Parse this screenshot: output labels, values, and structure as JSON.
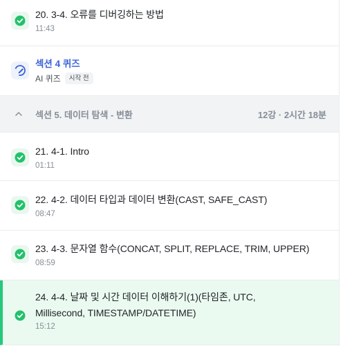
{
  "lessons_top": [
    {
      "title": "20. 3-4. 오류를 디버깅하는 방법",
      "time": "11:43"
    }
  ],
  "quiz": {
    "title": "섹션 4 퀴즈",
    "label": "AI 퀴즈",
    "badge": "시작 전"
  },
  "section": {
    "title": "섹션 5. 데이터 탐색 - 변환",
    "meta": "12강 · 2시간 18분"
  },
  "lessons": [
    {
      "title": "21. 4-1. Intro",
      "time": "01:11"
    },
    {
      "title": "22. 4-2. 데이터 타입과 데이터 변환(CAST, SAFE_CAST)",
      "time": "08:47"
    },
    {
      "title": "23. 4-3. 문자열 함수(CONCAT, SPLIT, REPLACE, TRIM, UPPER)",
      "time": "08:59"
    },
    {
      "title": "24. 4-4. 날짜 및 시간 데이터 이해하기(1)(타임존, UTC, Millisecond, TIMESTAMP/DATETIME)",
      "time": "15:12"
    }
  ],
  "colors": {
    "check_green": "#22c16b",
    "quiz_blue": "#3b62d6",
    "active_bg": "#ebfaf1",
    "active_border": "#26c97c"
  }
}
